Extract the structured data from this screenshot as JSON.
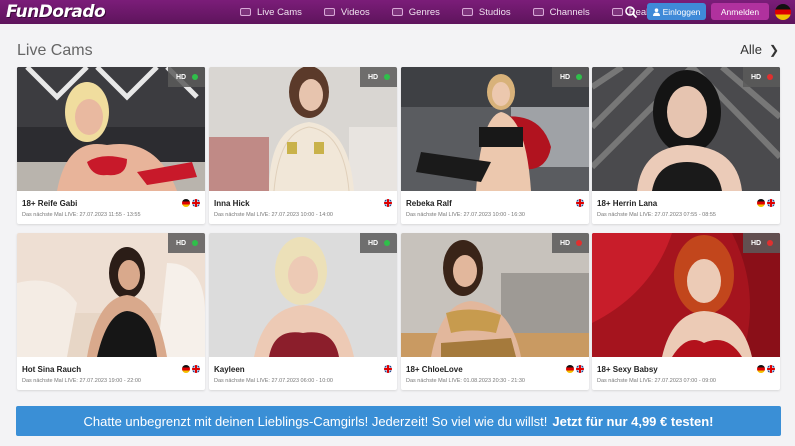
{
  "header": {
    "logo": "FunDorado",
    "nav": [
      {
        "label": "Live Cams",
        "icon": "camera-icon"
      },
      {
        "label": "Videos",
        "icon": "video-icon"
      },
      {
        "label": "Genres",
        "icon": "image-icon"
      },
      {
        "label": "Studios",
        "icon": "monitor-icon"
      },
      {
        "label": "Channels",
        "icon": "tv-icon"
      },
      {
        "label": "Reality",
        "icon": "reality-icon"
      }
    ],
    "login_label": "Einloggen",
    "register_label": "Anmelden",
    "language": "de-flag-icon"
  },
  "section": {
    "title": "Live Cams",
    "all_label": "Alle"
  },
  "colors": {
    "brand": "#6b1a69",
    "login": "#3f8ad8",
    "register": "#b0319e",
    "banner": "#3a8fd6",
    "online": "#2fbf4a",
    "offline": "#e0302f"
  },
  "cams": [
    {
      "name": "18+ Reife Gabi",
      "schedule": "Das nächste Mal LIVE: 27.07.2023 11:55 - 13:55",
      "hd": "HD",
      "status": "online",
      "flags": [
        "de",
        "gb"
      ]
    },
    {
      "name": "Inna Hick",
      "schedule": "Das nächste Mal LIVE: 27.07.2023 10:00 - 14:00",
      "hd": "HD",
      "status": "online",
      "flags": [
        "gb"
      ]
    },
    {
      "name": "Rebeka Ralf",
      "schedule": "Das nächste Mal LIVE: 27.07.2023 10:00 - 16:30",
      "hd": "HD",
      "status": "online",
      "flags": [
        "gb"
      ]
    },
    {
      "name": "18+ Herrin Lana",
      "schedule": "Das nächste Mal LIVE: 27.07.2023 07:55 - 08:55",
      "hd": "HD",
      "status": "offline",
      "flags": [
        "de",
        "gb"
      ]
    },
    {
      "name": "Hot Sina Rauch",
      "schedule": "Das nächste Mal LIVE: 27.07.2023 19:00 - 22:00",
      "hd": "HD",
      "status": "online",
      "flags": [
        "de",
        "gb"
      ]
    },
    {
      "name": "Kayleen",
      "schedule": "Das nächste Mal LIVE: 27.07.2023 06:00 - 10:00",
      "hd": "HD",
      "status": "online",
      "flags": [
        "gb"
      ]
    },
    {
      "name": "18+ ChloeLove",
      "schedule": "Das nächste Mal LIVE: 01.08.2023 20:30 - 21:30",
      "hd": "HD",
      "status": "offline",
      "flags": [
        "de",
        "gb"
      ]
    },
    {
      "name": "18+ Sexy Babsy",
      "schedule": "Das nächste Mal LIVE: 27.07.2023 07:00 - 09:00",
      "hd": "HD",
      "status": "offline",
      "flags": [
        "de",
        "gb"
      ]
    }
  ],
  "banner": {
    "text": "Chatte unbegrenzt mit deinen Lieblings-Camgirls! Jederzeit! So viel wie du willst!",
    "cta": "Jetzt für nur 4,99 € testen!"
  }
}
